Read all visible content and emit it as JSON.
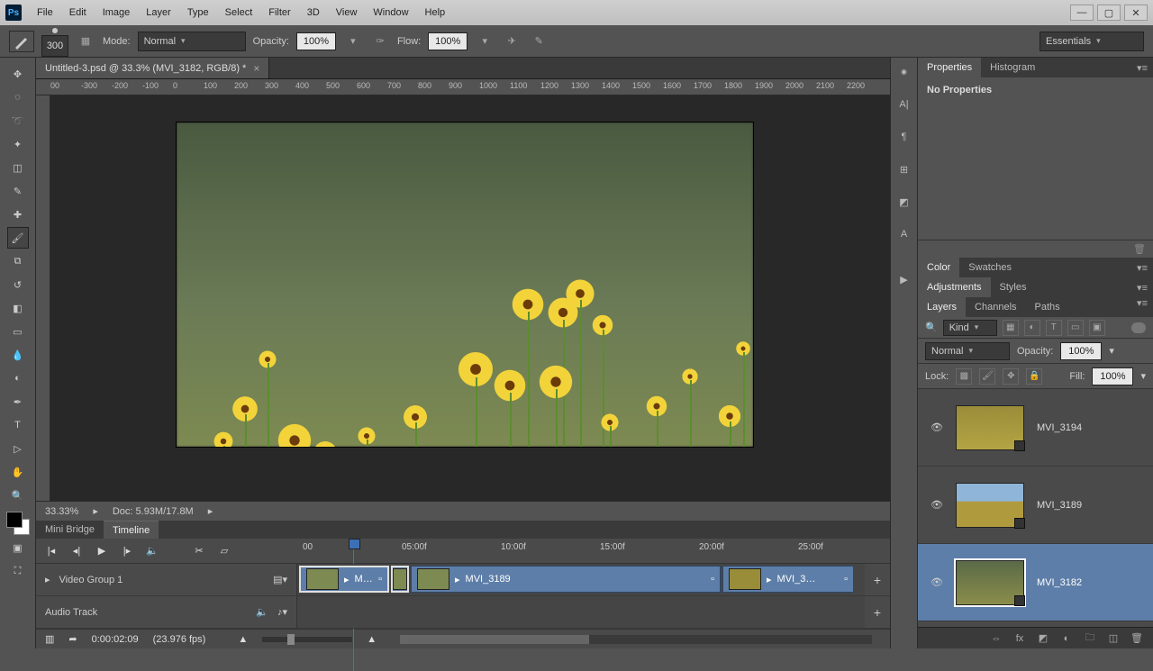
{
  "menu": {
    "file": "File",
    "edit": "Edit",
    "image": "Image",
    "layer": "Layer",
    "type": "Type",
    "select": "Select",
    "filter": "Filter",
    "threeD": "3D",
    "view": "View",
    "window": "Window",
    "help": "Help"
  },
  "options": {
    "brush_size": "300",
    "mode_label": "Mode:",
    "mode_value": "Normal",
    "opacity_label": "Opacity:",
    "opacity_value": "100%",
    "flow_label": "Flow:",
    "flow_value": "100%",
    "workspace": "Essentials"
  },
  "document": {
    "tab_title": "Untitled-3.psd @ 33.3% (MVI_3182, RGB/8) *",
    "ruler_values": [
      "00",
      "-300",
      "-200",
      "-100",
      "0",
      "100",
      "200",
      "300",
      "400",
      "500",
      "600",
      "700",
      "800",
      "900",
      "1000",
      "1100",
      "1200",
      "1300",
      "1400",
      "1500",
      "1600",
      "1700",
      "1800",
      "1900",
      "2000",
      "2100",
      "2200"
    ],
    "zoom": "33.33%",
    "doc_size": "Doc: 5.93M/17.8M"
  },
  "bottom_tabs": {
    "mini_bridge": "Mini Bridge",
    "timeline": "Timeline"
  },
  "timeline": {
    "ruler": [
      "00",
      "05:00f",
      "10:00f",
      "15:00f",
      "20:00f",
      "25:00f"
    ],
    "track_group": "Video Group 1",
    "audio_track": "Audio Track",
    "clip1": "M…",
    "clip2": "MVI_3189",
    "clip3": "MVI_3…",
    "time_current": "0:00:02:09",
    "fps": "(23.976 fps)"
  },
  "properties": {
    "tab_properties": "Properties",
    "tab_histogram": "Histogram",
    "no_props": "No Properties"
  },
  "color_panel": {
    "color": "Color",
    "swatches": "Swatches"
  },
  "adjustments_panel": {
    "adjustments": "Adjustments",
    "styles": "Styles"
  },
  "layers": {
    "tab_layers": "Layers",
    "tab_channels": "Channels",
    "tab_paths": "Paths",
    "kind": "Kind",
    "blend": "Normal",
    "opacity_label": "Opacity:",
    "opacity_value": "100%",
    "lock_label": "Lock:",
    "fill_label": "Fill:",
    "fill_value": "100%",
    "items": [
      {
        "name": "MVI_3194"
      },
      {
        "name": "MVI_3189"
      },
      {
        "name": "MVI_3182"
      }
    ]
  }
}
